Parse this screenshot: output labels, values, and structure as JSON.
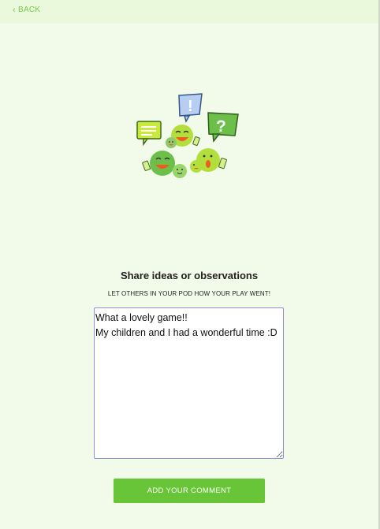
{
  "nav": {
    "back_label": "BACK"
  },
  "heading": {
    "title": "Share ideas or observations",
    "subtitle": "LET OTHERS IN YOUR POD HOW YOUR PLAY WENT!"
  },
  "comment": {
    "value": "What a lovely game!!\nMy children and I had a wonderful time :D"
  },
  "submit": {
    "label": "ADD YOUR COMMENT"
  },
  "illustration": {
    "icon": "chatting-characters-icon"
  },
  "colors": {
    "background": "#f2fbe9",
    "accent_green": "#67c537",
    "back_link": "#79c84a",
    "textarea_border": "#8f8fd8"
  }
}
